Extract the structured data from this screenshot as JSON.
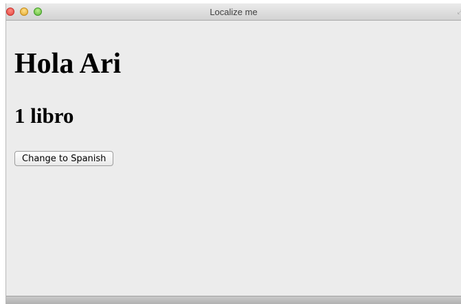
{
  "window": {
    "title": "Localize me"
  },
  "main": {
    "greeting": "Hola Ari",
    "book_count": "1 libro",
    "change_language_button": "Change to Spanish"
  }
}
